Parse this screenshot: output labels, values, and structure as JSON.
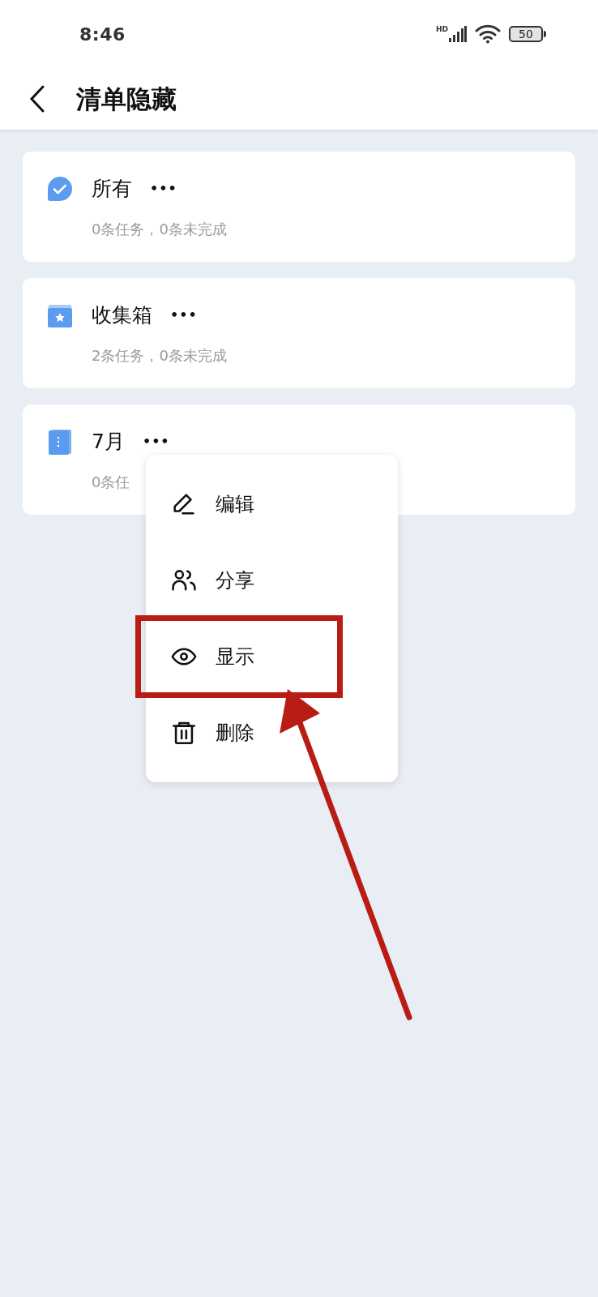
{
  "status_bar": {
    "time": "8:46",
    "network": "HD",
    "battery": "50"
  },
  "header": {
    "title": "清单隐藏"
  },
  "lists": [
    {
      "kind": "all",
      "name": "所有",
      "more": "•••",
      "summary": "0条任务，0条未完成"
    },
    {
      "kind": "inbox",
      "name": "收集箱",
      "more": "•••",
      "summary": "2条任务，0条未完成"
    },
    {
      "kind": "folder",
      "name": "7月",
      "more": "•••",
      "summary": "0条任"
    }
  ],
  "menu": {
    "items": [
      {
        "kind": "edit",
        "label": "编辑",
        "highlighted": false
      },
      {
        "kind": "share",
        "label": "分享",
        "highlighted": false
      },
      {
        "kind": "show",
        "label": "显示",
        "highlighted": true
      },
      {
        "kind": "delete",
        "label": "删除",
        "highlighted": false
      }
    ]
  }
}
